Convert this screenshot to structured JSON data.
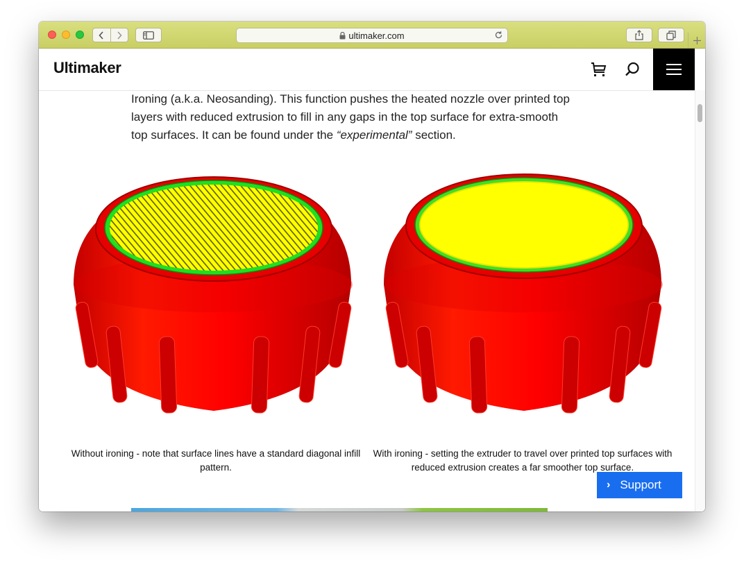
{
  "browser": {
    "url": "ultimaker.com"
  },
  "site": {
    "logo": "Ultimaker"
  },
  "article": {
    "intro_line1_pre": "Ironing (a.k.a. Neosanding). This function pushes the heated nozzle over printed top",
    "intro_line2": "layers with reduced extrusion to fill in any gaps in the top surface for extra-smooth",
    "intro_line3_pre": "top surfaces. It can be found under the ",
    "intro_line3_em": "“experimental”",
    "intro_line3_post": " section."
  },
  "figures": {
    "left_caption": "Without ironing - note that surface lines have a standard diagonal infill pattern.",
    "right_caption": "With ironing - setting the extruder to travel over printed top surfaces with reduced extrusion creates a far smoother top surface."
  },
  "support": {
    "label": "Support"
  },
  "colors": {
    "model_red": "#ff0000",
    "top_yellow": "#ffff00",
    "outline_green": "#22dd22",
    "support_blue": "#196ef0"
  }
}
